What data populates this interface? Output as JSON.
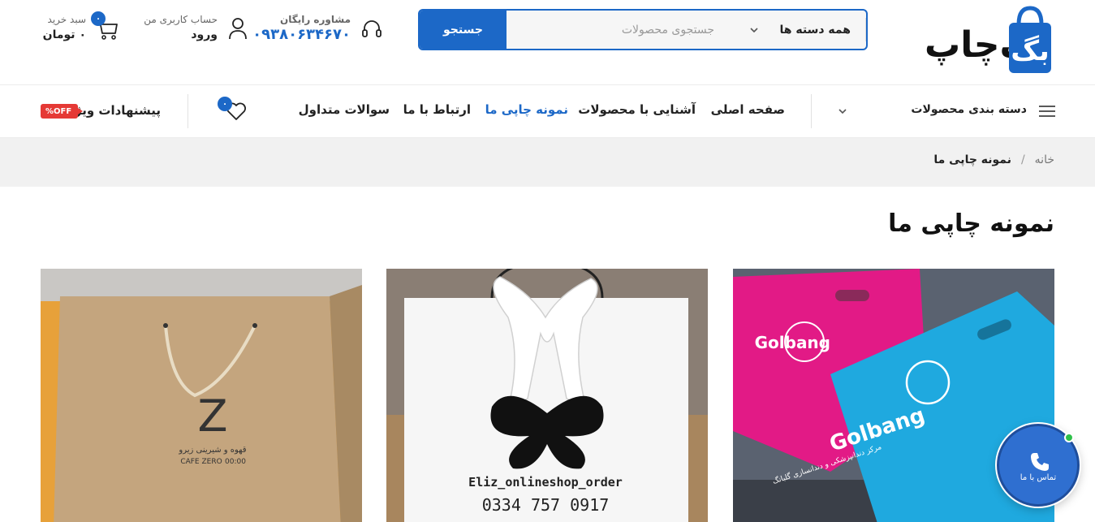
{
  "brand": {
    "logo_text": "بگ‌چاپ",
    "accent": "#1c68c7"
  },
  "search": {
    "button_label": "جستجو",
    "placeholder": "جستجوی محصولات",
    "category_label": "همه دسته ها"
  },
  "consult": {
    "label": "مشاوره رایگان",
    "phone": "۰۹۳۸۰۶۳۴۶۷۰"
  },
  "account": {
    "label": "حساب کاربری من",
    "login": "ورود"
  },
  "cart": {
    "label": "سبد خرید",
    "total": "۰ تومان",
    "count": "۰"
  },
  "nav": {
    "category_menu": "دسته بندی محصولات",
    "links": [
      "صفحه اصلی",
      "آشنایی با محصولات",
      "نمونه چاپی ما",
      "ارتباط با ما",
      "سوالات متداول"
    ],
    "active_index": 2,
    "wishlist_count": "۰",
    "special_offers": "پیشنهادات ویژه",
    "off_badge": "%OFF"
  },
  "breadcrumb": {
    "home": "خانه",
    "separator": "/",
    "current": "نمونه چاپی ما"
  },
  "page_title": "نمونه چاپی ما",
  "gallery": [
    {
      "name": "golbang-bags",
      "bag_text": "Golbang",
      "bag_text_2": "Golbang",
      "caption": "مرکز دندانپزشکی و دندانسازی گلبانگ"
    },
    {
      "name": "eliz-bag",
      "handle": "Eliz_onlineshop_order",
      "phone": "0917 757 0334"
    },
    {
      "name": "cafe-zero-bag",
      "brand_letter": "Z",
      "brand_fa": "قهوه و شیرینی زیرو",
      "brand_en": "CAFE ZERO",
      "hours": "00:00"
    }
  ],
  "contact": {
    "label": "تماس با ما"
  }
}
